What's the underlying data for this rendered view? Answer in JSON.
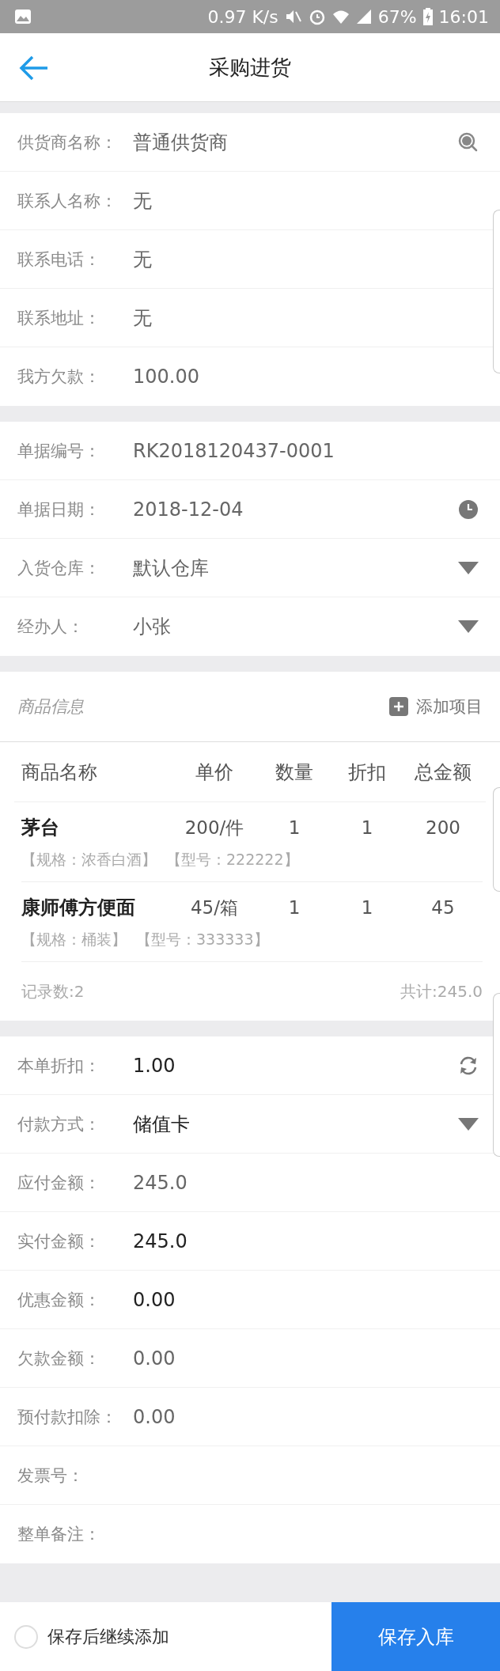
{
  "status_bar": {
    "speed": "0.97 K/s",
    "battery": "67%",
    "time": "16:01"
  },
  "header": {
    "title": "采购进货"
  },
  "sections": [
    {
      "rows": [
        {
          "label": "供货商名称：",
          "value": "普通供货商",
          "editable": false,
          "kind": "search"
        },
        {
          "label": "联系人名称：",
          "value": "无",
          "editable": false
        },
        {
          "label": "联系电话：",
          "value": "无",
          "editable": false
        },
        {
          "label": "联系地址：",
          "value": "无",
          "editable": false
        },
        {
          "label": "我方欠款：",
          "value": "100.00",
          "editable": false
        }
      ]
    },
    {
      "rows": [
        {
          "label": "单据编号：",
          "value": "RK2018120437-0001",
          "editable": false
        },
        {
          "label": "单据日期：",
          "value": "2018-12-04",
          "editable": false,
          "kind": "date"
        },
        {
          "label": "入货仓库：",
          "value": "默认仓库",
          "editable": false,
          "kind": "select"
        },
        {
          "label": "经办人：",
          "value": "小张",
          "editable": false,
          "kind": "select"
        }
      ]
    }
  ],
  "products": {
    "title": "商品信息",
    "add_label": "添加项目",
    "columns": [
      "商品名称",
      "单价",
      "数量",
      "折扣",
      "总金额"
    ],
    "rows": [
      {
        "name": "茅台",
        "price": "200/件",
        "qty": "1",
        "discount": "1",
        "total": "200",
        "spec": "【规格：浓香白酒】",
        "model": "【型号：222222】"
      },
      {
        "name": "康师傅方便面",
        "price": "45/箱",
        "qty": "1",
        "discount": "1",
        "total": "45",
        "spec": "【规格：桶装】",
        "model": "【型号：333333】"
      }
    ],
    "record_count": "记录数:2",
    "sum": "共计:245.0"
  },
  "payment_rows": [
    {
      "label": "本单折扣：",
      "value": "1.00",
      "editable": true,
      "kind": "reset"
    },
    {
      "label": "付款方式：",
      "value": "储值卡",
      "editable": true,
      "kind": "select"
    },
    {
      "label": "应付金额：",
      "value": "245.0",
      "editable": false
    },
    {
      "label": "实付金额：",
      "value": "245.0",
      "editable": true
    },
    {
      "label": "优惠金额：",
      "value": "0.00",
      "editable": true
    },
    {
      "label": "欠款金额：",
      "value": "0.00",
      "editable": false
    },
    {
      "label": "预付款扣除：",
      "value": "0.00",
      "editable": false
    },
    {
      "label": "发票号："
    },
    {
      "label": "整单备注："
    }
  ],
  "footer": {
    "continue_label": "保存后继续添加",
    "continue_checked": false,
    "save_label": "保存入库"
  }
}
